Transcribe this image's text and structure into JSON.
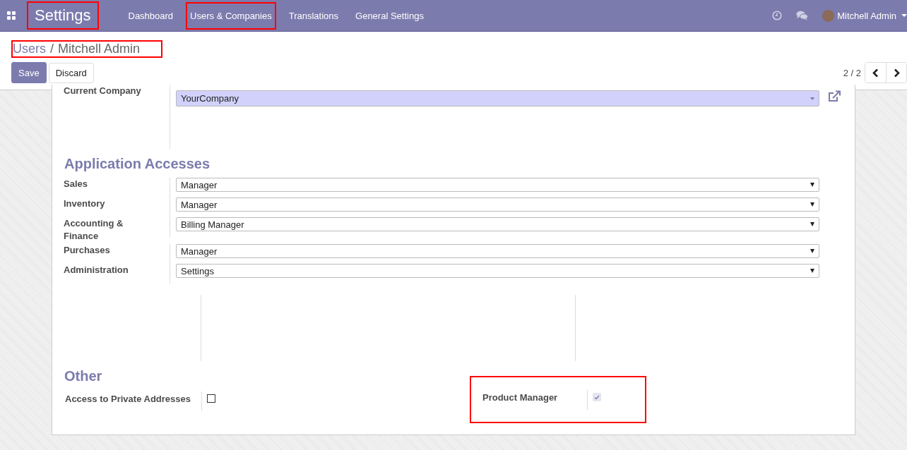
{
  "navbar": {
    "app_title": "Settings",
    "app_title_highlighted": true,
    "menu": [
      {
        "label": "Dashboard",
        "highlighted": false
      },
      {
        "label": "Users & Companies",
        "highlighted": true
      },
      {
        "label": "Translations",
        "highlighted": false
      },
      {
        "label": "General Settings",
        "highlighted": false
      }
    ],
    "user": "Mitchell Admin"
  },
  "breadcrumb": {
    "parent": "Users",
    "separator": "/",
    "current": "Mitchell Admin",
    "highlighted": true
  },
  "buttons": {
    "save": "Save",
    "discard": "Discard"
  },
  "pager": "2 / 2",
  "current_company": {
    "label": "Current Company",
    "value": "YourCompany"
  },
  "application_accesses": {
    "title": "Application Accesses",
    "rows": [
      {
        "label": "Sales",
        "value": "Manager"
      },
      {
        "label": "Inventory",
        "value": "Manager"
      },
      {
        "label": "Accounting & Finance",
        "value": "Billing Manager"
      },
      {
        "label": "Purchases",
        "value": "Manager"
      },
      {
        "label": "Administration",
        "value": "Settings"
      }
    ]
  },
  "other": {
    "title": "Other",
    "fields": [
      {
        "label": "Access to Private Addresses",
        "checked": false,
        "disabled": false,
        "highlighted": false
      },
      {
        "label": "Product Manager",
        "checked": true,
        "disabled": true,
        "highlighted": true
      }
    ]
  }
}
